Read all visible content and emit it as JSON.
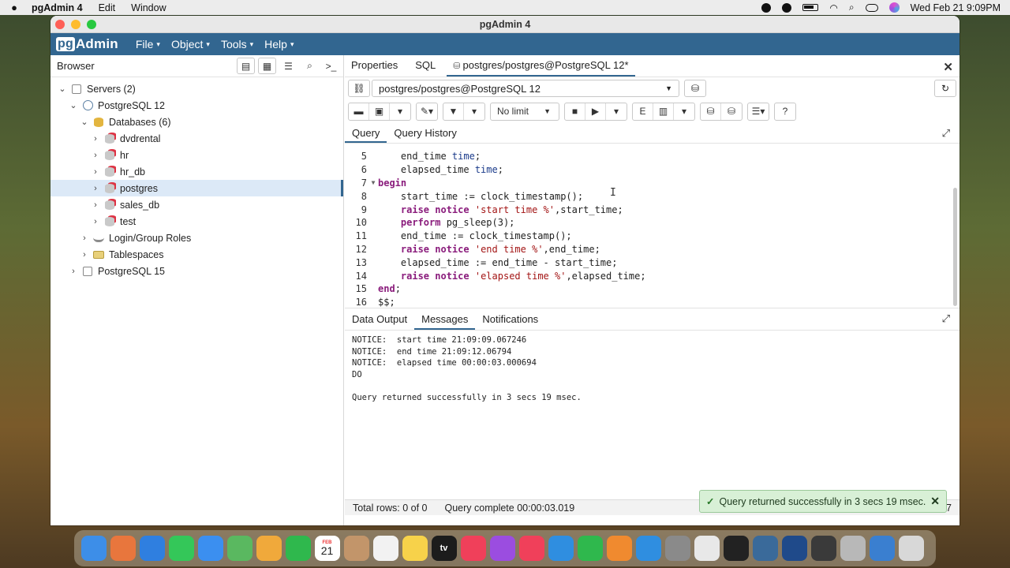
{
  "menubar": {
    "app_name": "pgAdmin 4",
    "items": [
      "Edit",
      "Window"
    ],
    "datetime": "Wed Feb 21  9:09PM"
  },
  "window": {
    "title": "pgAdmin 4"
  },
  "appbar": {
    "logo_pg": "pg",
    "logo_rest": "Admin",
    "menus": [
      "File",
      "Object",
      "Tools",
      "Help"
    ]
  },
  "browser": {
    "title": "Browser",
    "tree": [
      {
        "label": "Servers (2)",
        "depth": 0,
        "toggle": "open",
        "icon": "server-group-icon"
      },
      {
        "label": "PostgreSQL 12",
        "depth": 1,
        "toggle": "open",
        "icon": "elephant-icon"
      },
      {
        "label": "Databases (6)",
        "depth": 2,
        "toggle": "open",
        "icon": "databases-icon"
      },
      {
        "label": "dvdrental",
        "depth": 3,
        "toggle": "closed",
        "icon": "database-icon"
      },
      {
        "label": "hr",
        "depth": 3,
        "toggle": "closed",
        "icon": "database-icon"
      },
      {
        "label": "hr_db",
        "depth": 3,
        "toggle": "closed",
        "icon": "database-icon"
      },
      {
        "label": "postgres",
        "depth": 3,
        "toggle": "closed",
        "icon": "database-icon",
        "selected": true
      },
      {
        "label": "sales_db",
        "depth": 3,
        "toggle": "closed",
        "icon": "database-icon"
      },
      {
        "label": "test",
        "depth": 3,
        "toggle": "closed",
        "icon": "database-icon"
      },
      {
        "label": "Login/Group Roles",
        "depth": 2,
        "toggle": "closed",
        "icon": "roles-icon"
      },
      {
        "label": "Tablespaces",
        "depth": 2,
        "toggle": "closed",
        "icon": "folder-icon"
      },
      {
        "label": "PostgreSQL 15",
        "depth": 1,
        "toggle": "closed",
        "icon": "server-disconnected-icon"
      }
    ]
  },
  "main": {
    "tabs": [
      {
        "label": "Properties"
      },
      {
        "label": "SQL"
      },
      {
        "label": "postgres/postgres@PostgreSQL 12*",
        "active": true
      }
    ],
    "connection": "postgres/postgres@PostgreSQL 12",
    "limit": "No limit",
    "subtabs": [
      {
        "label": "Query",
        "active": true
      },
      {
        "label": "Query History"
      }
    ],
    "code": [
      {
        "n": "5",
        "tokens": [
          [
            "code",
            "    end_time "
          ],
          [
            "ty",
            "time"
          ],
          [
            "code",
            ";"
          ]
        ]
      },
      {
        "n": "6",
        "tokens": [
          [
            "code",
            "    elapsed_time "
          ],
          [
            "ty",
            "time"
          ],
          [
            "code",
            ";"
          ]
        ]
      },
      {
        "n": "7",
        "fold": "▼",
        "tokens": [
          [
            "kw",
            "begin"
          ]
        ]
      },
      {
        "n": "8",
        "tokens": [
          [
            "code",
            "    start_time := clock_timestamp();"
          ]
        ]
      },
      {
        "n": "9",
        "tokens": [
          [
            "code",
            "    "
          ],
          [
            "kw",
            "raise notice"
          ],
          [
            "code",
            " "
          ],
          [
            "str",
            "'start time %'"
          ],
          [
            "code",
            ",start_time;"
          ]
        ]
      },
      {
        "n": "10",
        "tokens": [
          [
            "code",
            "    "
          ],
          [
            "kw",
            "perform"
          ],
          [
            "code",
            " pg_sleep(3);"
          ]
        ]
      },
      {
        "n": "11",
        "tokens": [
          [
            "code",
            "    end_time := clock_timestamp();"
          ]
        ]
      },
      {
        "n": "12",
        "tokens": [
          [
            "code",
            "    "
          ],
          [
            "kw",
            "raise notice"
          ],
          [
            "code",
            " "
          ],
          [
            "str",
            "'end time %'"
          ],
          [
            "code",
            ",end_time;"
          ]
        ]
      },
      {
        "n": "13",
        "tokens": [
          [
            "code",
            "    elapsed_time := end_time - start_time;"
          ]
        ]
      },
      {
        "n": "14",
        "tokens": [
          [
            "code",
            "    "
          ],
          [
            "kw",
            "raise notice"
          ],
          [
            "code",
            " "
          ],
          [
            "str",
            "'elapsed time %'"
          ],
          [
            "code",
            ",elapsed_time;"
          ]
        ]
      },
      {
        "n": "15",
        "tokens": [
          [
            "kw",
            "end"
          ],
          [
            "code",
            ";"
          ]
        ]
      },
      {
        "n": "16",
        "tokens": [
          [
            "code",
            "$$;"
          ]
        ]
      }
    ],
    "output_tabs": [
      {
        "label": "Data Output"
      },
      {
        "label": "Messages",
        "active": true
      },
      {
        "label": "Notifications"
      }
    ],
    "messages": [
      "NOTICE:  start time 21:09:09.067246",
      "NOTICE:  end time 21:09:12.06794",
      "NOTICE:  elapsed time 00:00:03.000694",
      "DO",
      "",
      "Query returned successfully in 3 secs 19 msec."
    ],
    "status": {
      "rows": "Total rows: 0 of 0",
      "complete": "Query complete 00:00:03.019",
      "trailing": "7"
    },
    "toast": "Query returned successfully in 3 secs 19 msec."
  },
  "dock": {
    "apps": [
      {
        "name": "finder-icon",
        "color": "#3d8ee8"
      },
      {
        "name": "launchpad-icon",
        "color": "#e8763d"
      },
      {
        "name": "safari-icon",
        "color": "#2f7fe0"
      },
      {
        "name": "messages-icon",
        "color": "#34c759"
      },
      {
        "name": "mail-icon",
        "color": "#3b8ff0"
      },
      {
        "name": "maps-icon",
        "color": "#5ab860"
      },
      {
        "name": "photos-icon",
        "color": "#f0a93b"
      },
      {
        "name": "facetime-icon",
        "color": "#2fb84d"
      },
      {
        "name": "calendar-icon",
        "color": "#ffffff"
      },
      {
        "name": "contacts-icon",
        "color": "#c2956a"
      },
      {
        "name": "reminders-icon",
        "color": "#f2f2f2"
      },
      {
        "name": "notes-icon",
        "color": "#f7d24a"
      },
      {
        "name": "tv-icon",
        "color": "#1c1c1c"
      },
      {
        "name": "music-icon",
        "color": "#f0405a"
      },
      {
        "name": "podcasts-icon",
        "color": "#9b4de0"
      },
      {
        "name": "news-icon",
        "color": "#f0405a"
      },
      {
        "name": "keynote-icon",
        "color": "#2f8ee0"
      },
      {
        "name": "numbers-icon",
        "color": "#2fb84d"
      },
      {
        "name": "pages-icon",
        "color": "#f08a2f"
      },
      {
        "name": "app-store-icon",
        "color": "#2f8ee0"
      },
      {
        "name": "system-settings-icon",
        "color": "#8a8a8a"
      },
      {
        "name": "chrome-icon",
        "color": "#e8e8e8"
      },
      {
        "name": "terminal-icon",
        "color": "#222222"
      },
      {
        "name": "pgadmin-icon",
        "color": "#3a6a9a"
      },
      {
        "name": "virtualbox-icon",
        "color": "#1f4a8a"
      },
      {
        "name": "vm-screen-icon",
        "color": "#3a3a3a"
      },
      {
        "name": "database-tool-icon",
        "color": "#b8b8b8"
      },
      {
        "name": "quicktime-icon",
        "color": "#3a7fd0"
      },
      {
        "name": "trash-icon",
        "color": "#d8d8d8"
      }
    ],
    "calendar_month": "FEB",
    "calendar_day": "21",
    "tv_label": "tv"
  }
}
